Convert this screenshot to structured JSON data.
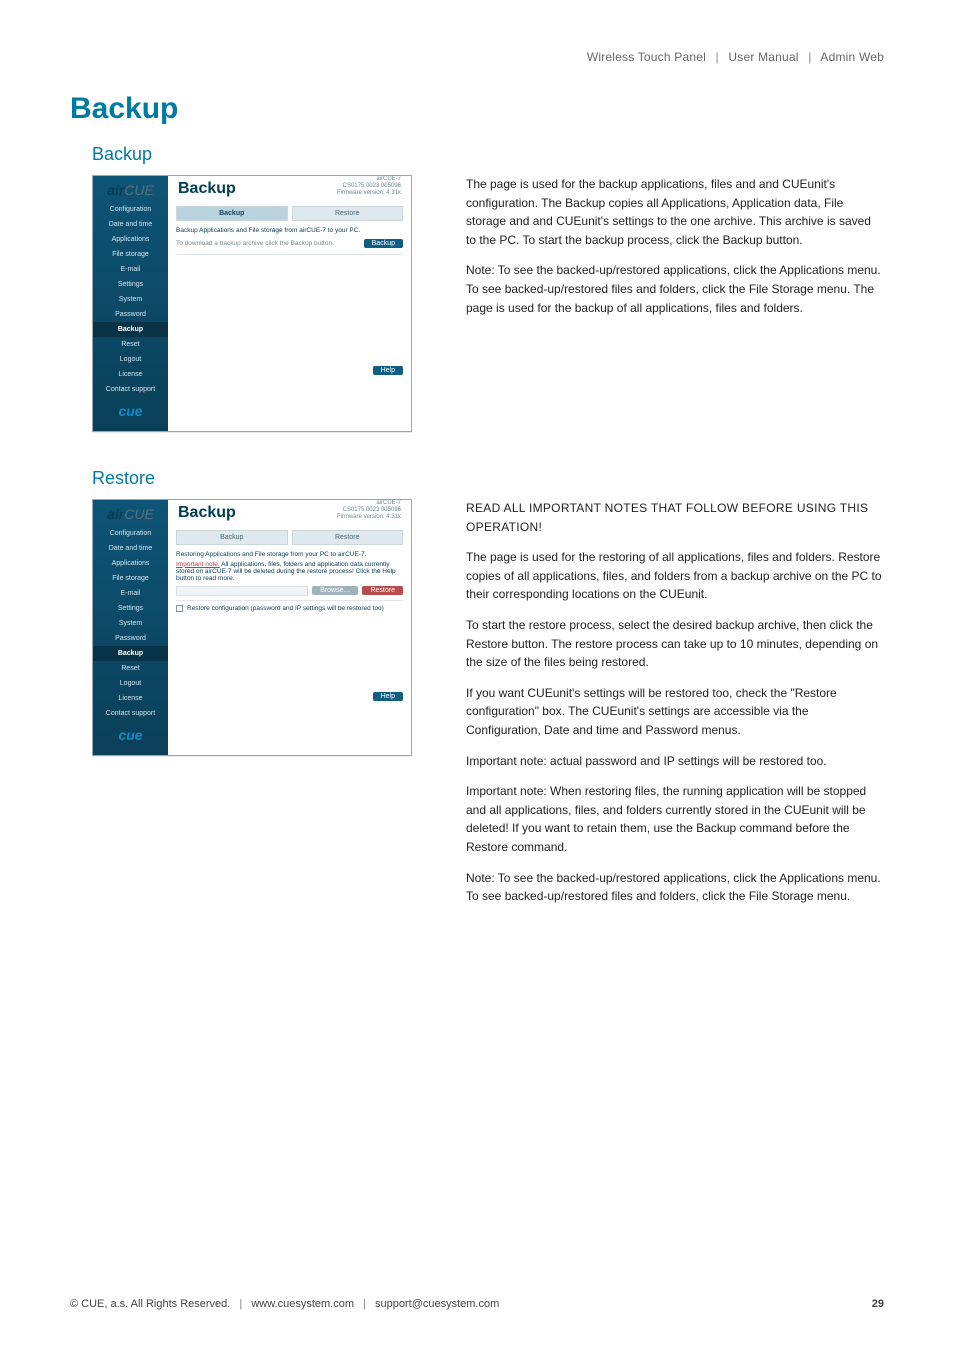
{
  "breadcrumb": {
    "a": "Wireless Touch Panel",
    "b": "User Manual",
    "c": "Admin Web",
    "sep": "|"
  },
  "page_title": "Backup",
  "sections": {
    "backup": {
      "title": "Backup",
      "prose": [
        "The page is used for the backup applications, files and and CUEunit's configuration. The Backup copies all Applications, Application data, File storage and and CUEunit's settings to the one archive. This archive is saved to the PC. To start the backup process, click the Backup button.",
        "Note: To see the backed-up/restored applications, click the Applications menu. To see backed-up/restored files and folders, click the File Storage menu. The page is used for the backup of all applications, files and folders."
      ]
    },
    "restore": {
      "title": "Restore",
      "caps_line": "Read all important notes that follow before using this operation!",
      "prose": [
        "The page is used for the restoring of all applications, files and folders. Restore copies of all applications, files, and folders from a backup archive on the PC to their corresponding locations on the CUEunit.",
        "To start the restore process, select the desired backup archive, then click the Restore button. The restore process can take up to 10 minutes, depending on the size of the files being restored.",
        "If you want CUEunit's settings will be restored too, check the \"Restore configuration\" box. The CUEunit's settings are accessible via the Configuration, Date and time and Password menus.",
        "Important note: actual password and IP settings will be restored too.",
        "Important note: When restoring files, the running application will be stopped and all applications, files, and folders currently stored in the CUEunit will be deleted! If you want to retain them, use the Backup command before the Restore command.",
        "Note: To see the backed-up/restored applications, click the Applications menu. To see backed-up/restored files and folders, click the File Storage menu."
      ]
    }
  },
  "shot_common": {
    "brand_air": "air",
    "brand_cue": "CUE",
    "product": "airCUE-7",
    "serial": "CS0175.0023 005096",
    "fw": "Firmware version: 4.31k",
    "heading": "Backup",
    "tabs": {
      "backup": "Backup",
      "restore": "Restore"
    },
    "sidebar": [
      "Configuration",
      "Date and time",
      "Applications",
      "File storage",
      "E-mail",
      "Settings",
      "System",
      "Password",
      "Backup",
      "Reset",
      "Logout",
      "License",
      "Contact support"
    ],
    "help_btn": "Help",
    "foot_logo": "cue"
  },
  "shot_backup": {
    "line1": "Backup Applications and File storage from airCUE-7 to your PC.",
    "line2": "To download a backup archive click the Backup button.",
    "btn": "Backup"
  },
  "shot_restore": {
    "line1": "Restoring Applications and File storage from your PC to airCUE-7.",
    "imp_label": "Important note:",
    "imp_rest": " All applications, files, folders and application data currently stored on airCUE-7 will be deleted during the restore process! Click the Help button to read more.",
    "browse": "Browse…",
    "btn": "Restore",
    "check_label": "Restore configuration (password and IP settings will be restored too)"
  },
  "footer": {
    "copyright": "© CUE, a.s. All Rights Reserved.",
    "url": "www.cuesystem.com",
    "email": "support@cuesystem.com",
    "page": "29",
    "sep": "|"
  }
}
